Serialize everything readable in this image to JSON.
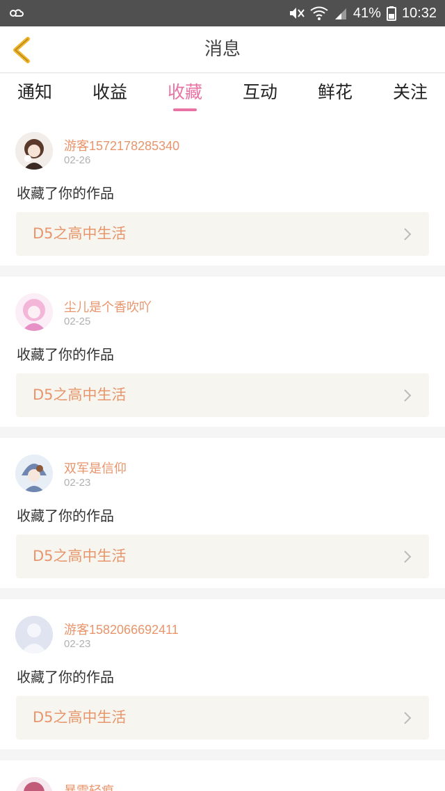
{
  "status_bar": {
    "battery": "41%",
    "time": "10:32",
    "icons": [
      "weather-icon",
      "mute-icon",
      "wifi-icon",
      "signal-icon",
      "battery-icon"
    ]
  },
  "header": {
    "title": "消息"
  },
  "tabs": [
    {
      "label": "通知",
      "active": false
    },
    {
      "label": "收益",
      "active": false
    },
    {
      "label": "收藏",
      "active": true
    },
    {
      "label": "互动",
      "active": false
    },
    {
      "label": "鲜花",
      "active": false
    },
    {
      "label": "关注",
      "active": false
    }
  ],
  "messages": [
    {
      "username": "游客1572178285340",
      "date": "02-26",
      "action": "收藏了你的作品",
      "work": "D5之高中生活"
    },
    {
      "username": "尘儿是个香吹吖",
      "date": "02-25",
      "action": "收藏了你的作品",
      "work": "D5之高中生活"
    },
    {
      "username": "双军是信仰",
      "date": "02-23",
      "action": "收藏了你的作品",
      "work": "D5之高中生活"
    },
    {
      "username": "游客1582066692411",
      "date": "02-23",
      "action": "收藏了你的作品",
      "work": "D5之高中生活"
    }
  ],
  "partial_message": {
    "username": "暴雪轻痕"
  },
  "colors": {
    "accent": "#e873a4",
    "orange": "#e8956b",
    "back_arrow": "#f0b429"
  }
}
